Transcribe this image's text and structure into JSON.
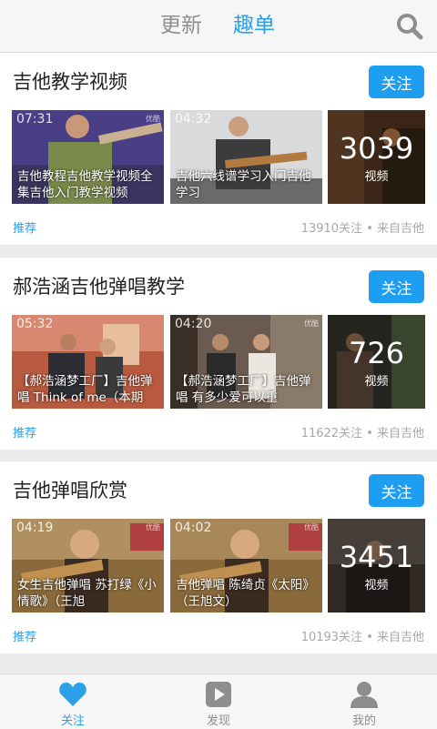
{
  "header": {
    "tabs": [
      {
        "label": "更新",
        "active": false
      },
      {
        "label": "趣单",
        "active": true
      }
    ],
    "search_icon": "search-icon"
  },
  "colors": {
    "accent": "#1e9ef0",
    "tab_active": "#2ba0e8",
    "tab_inactive": "#8e8e8e"
  },
  "cards": [
    {
      "title": "吉他教学视频",
      "follow_label": "关注",
      "videos": [
        {
          "duration": "07:31",
          "badge": "优酷",
          "caption": "吉他教程吉他教学视频全集吉他入门教学视频"
        },
        {
          "duration": "04:32",
          "badge": "",
          "caption": "吉他六线谱学习入门吉他学习"
        }
      ],
      "count": "3039",
      "count_label": "视频",
      "tag": "推荐",
      "meta": "13910关注 • 来自吉他"
    },
    {
      "title": "郝浩涵吉他弹唱教学",
      "follow_label": "关注",
      "videos": [
        {
          "duration": "05:32",
          "badge": "",
          "caption": "【郝浩涵梦工厂】吉他弹唱 Think of me（本期"
        },
        {
          "duration": "04:20",
          "badge": "优酷",
          "caption": "【郝浩涵梦工厂】吉他弹唱 有多少爱可以重"
        }
      ],
      "count": "726",
      "count_label": "视频",
      "tag": "推荐",
      "meta": "11622关注 • 来自吉他"
    },
    {
      "title": "吉他弹唱欣赏",
      "follow_label": "关注",
      "videos": [
        {
          "duration": "04:19",
          "badge": "优酷",
          "caption": "女生吉他弹唱 苏打绿《小情歌》（王旭"
        },
        {
          "duration": "04:02",
          "badge": "优酷",
          "caption": "吉他弹唱 陈绮贞《太阳》（王旭文）"
        }
      ],
      "count": "3451",
      "count_label": "视频",
      "tag": "推荐",
      "meta": "10193关注 • 来自吉他"
    }
  ],
  "bottom_nav": [
    {
      "label": "关注",
      "icon": "heart-icon",
      "active": true
    },
    {
      "label": "发现",
      "icon": "play-icon",
      "active": false
    },
    {
      "label": "我的",
      "icon": "person-icon",
      "active": false
    }
  ]
}
